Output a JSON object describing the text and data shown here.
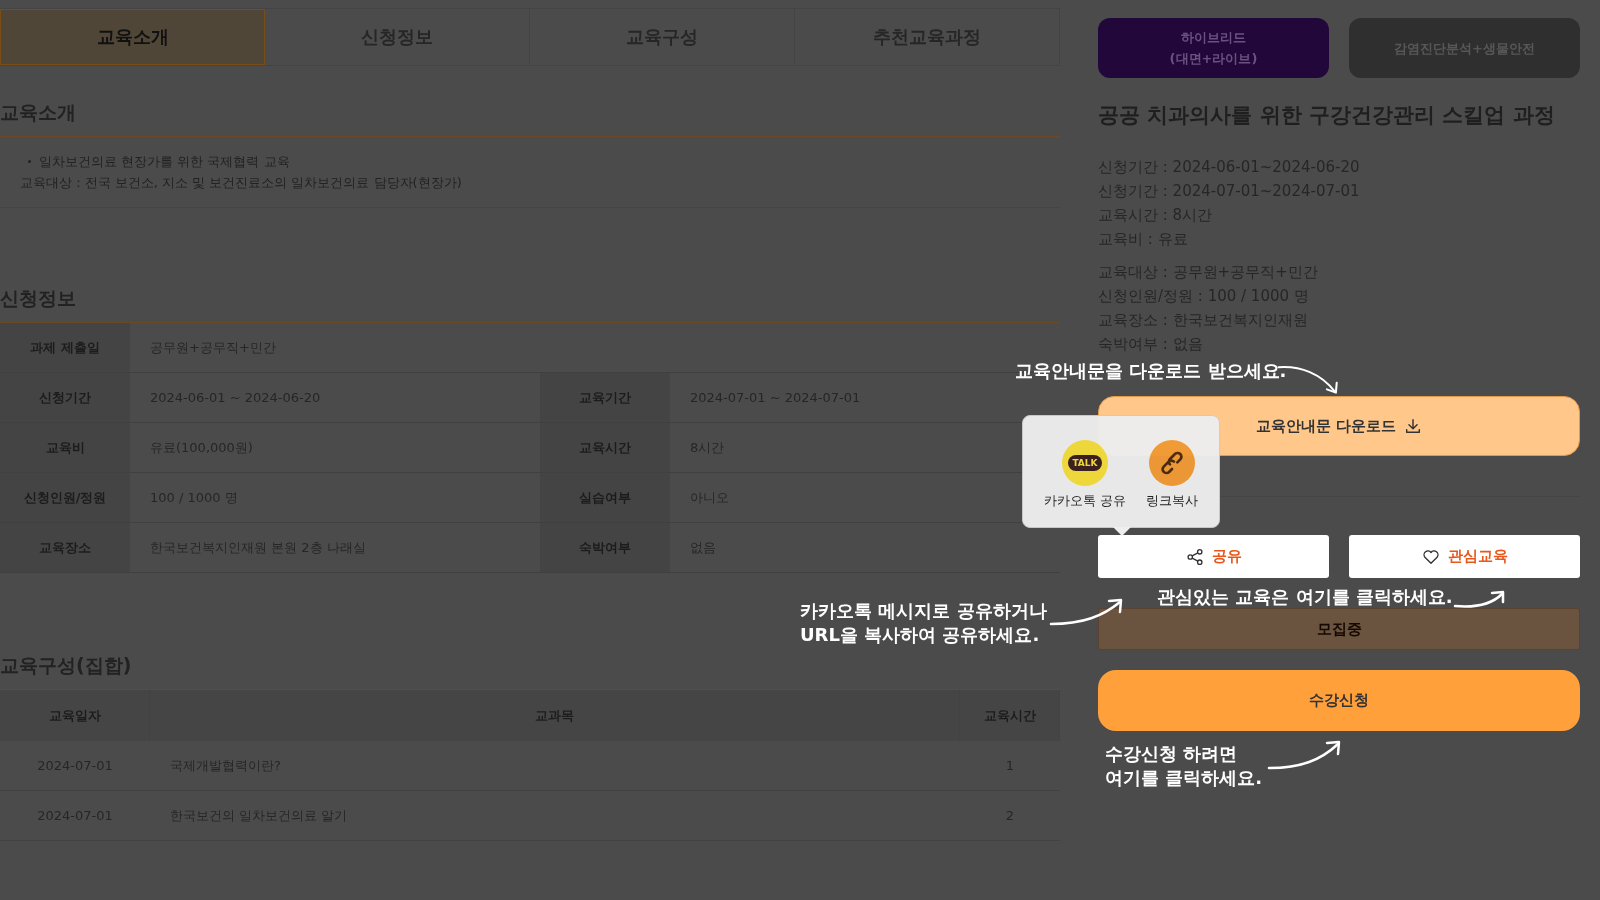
{
  "tabs": [
    {
      "label": "교육소개",
      "selected": true
    },
    {
      "label": "신청정보",
      "selected": false
    },
    {
      "label": "교육구성",
      "selected": false
    },
    {
      "label": "추천교육과정",
      "selected": false
    }
  ],
  "intro": {
    "heading": "교육소개",
    "bullets": [
      "일차보건의료 현장가를 위한 국제협력 교육"
    ],
    "text": "교육대상 : 전국 보건소, 지소 및 보건진료소의 일차보건의료 담당자(현장가)"
  },
  "apply_info": {
    "heading": "신청정보",
    "rows": [
      [
        {
          "label": "과제 제출일",
          "value": "공무원+공무직+민간"
        }
      ],
      [
        {
          "label": "신청기간",
          "value": "2024-06-01 ~ 2024-06-20"
        },
        {
          "label": "교육기간",
          "value": "2024-07-01 ~ 2024-07-01"
        }
      ],
      [
        {
          "label": "교육비",
          "value": "유료(100,000원)"
        },
        {
          "label": "교육시간",
          "value": "8시간"
        }
      ],
      [
        {
          "label": "신청인원/정원",
          "value": "100 / 1000 명"
        },
        {
          "label": "실습여부",
          "value": "아니오"
        }
      ],
      [
        {
          "label": "교육장소",
          "value": "한국보건복지인재원 본원 2층 나래실"
        },
        {
          "label": "숙박여부",
          "value": "없음"
        }
      ]
    ]
  },
  "curriculum": {
    "heading": "교육구성(집합)",
    "columns": [
      "교육일자",
      "교과목",
      "교육시간"
    ],
    "rows": [
      [
        "2024-07-01",
        "국제개발협력이란?",
        "1"
      ],
      [
        "2024-07-01",
        "한국보건의 일차보건의료 알기",
        "2"
      ]
    ]
  },
  "course": {
    "badges": [
      {
        "label": "하이브리드\n(대면+라이브)",
        "kind": "mode"
      },
      {
        "label": "감염진단분석+생물안전",
        "kind": "category"
      }
    ],
    "title": "공공 치과의사를 위한 구강건강관리 스킬업 과정",
    "details": [
      [
        "신청기간 : 2024-06-01~2024-06-20",
        "신청기간 : 2024-07-01~2024-07-01",
        "교육시간 : 8시간",
        "교육비 : 유료"
      ],
      [
        "교육대상 : 공무원+공무직+민간",
        "신청인원/정원 : 100 / 1000 명",
        "교육장소 : 한국보건복지인재원",
        "숙박여부 : 없음"
      ]
    ]
  },
  "download_button": "교육안내문 다운로드",
  "share_menu": {
    "items": [
      {
        "kind": "kakao",
        "badge": "TALK",
        "label": "카카오톡 공유"
      },
      {
        "kind": "link",
        "label": "링크복사"
      }
    ]
  },
  "share_button": "공유",
  "interest_button": "관심교육",
  "status_button": "모집중",
  "apply_button": "수강신청",
  "coach_marks": [
    {
      "text": "교육안내문을 다운로드 받으세요."
    },
    {
      "text": "카카오톡 메시지로 공유하거나\nURL을 복사하여 공유하세요."
    },
    {
      "text": "관심있는 교육은 여기를 클릭하세요."
    },
    {
      "text": "수강신청 하려면\n여기를 클릭하세요."
    }
  ]
}
